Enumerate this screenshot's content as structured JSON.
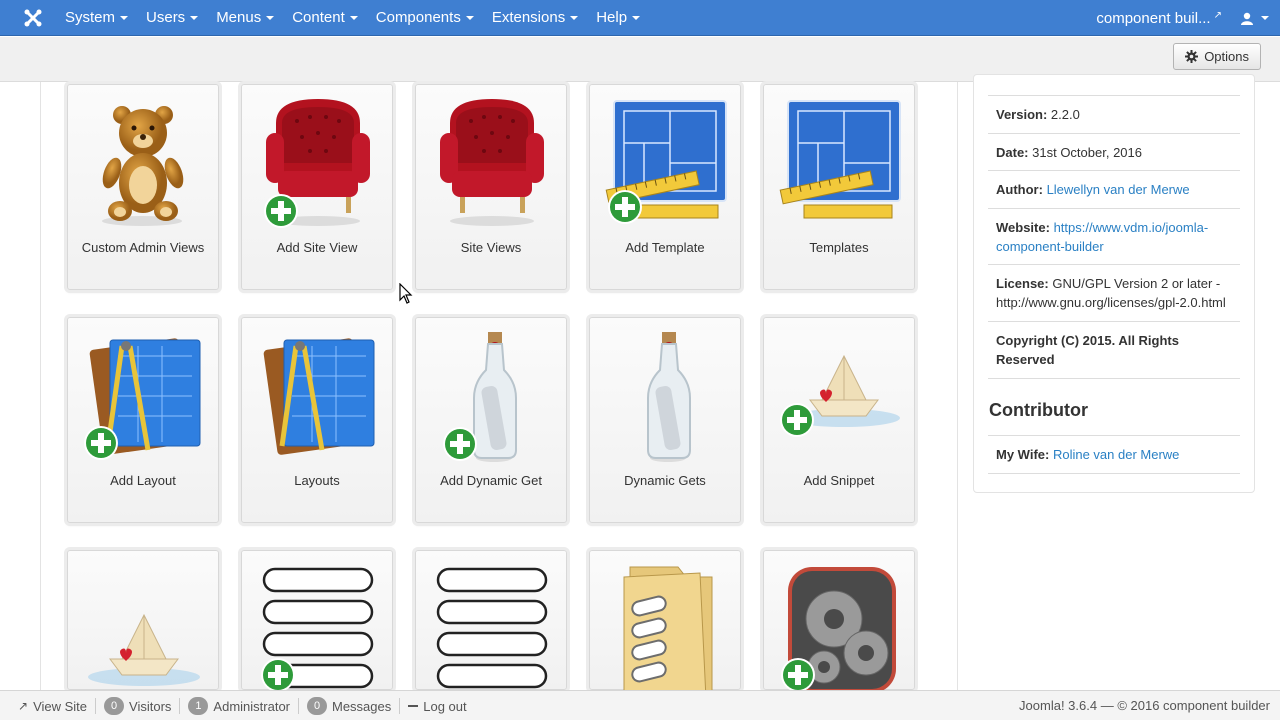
{
  "navbar": {
    "menu": [
      {
        "label": "System"
      },
      {
        "label": "Users"
      },
      {
        "label": "Menus"
      },
      {
        "label": "Content"
      },
      {
        "label": "Components"
      },
      {
        "label": "Extensions"
      },
      {
        "label": "Help"
      }
    ],
    "site_link": "component buil...",
    "accent_color": "#3f7fd1"
  },
  "toolbar": {
    "options_label": "Options"
  },
  "tiles": [
    {
      "label": "Custom Admin Views",
      "icon": "teddy-bear-icon"
    },
    {
      "label": "Add Site View",
      "icon": "armchair-icon"
    },
    {
      "label": "Site Views",
      "icon": "armchair-icon"
    },
    {
      "label": "Add Template",
      "icon": "blueprint-icon"
    },
    {
      "label": "Templates",
      "icon": "blueprint-icon"
    },
    {
      "label": "Add Layout",
      "icon": "drafting-book-icon"
    },
    {
      "label": "Layouts",
      "icon": "drafting-book-icon"
    },
    {
      "label": "Add Dynamic Get",
      "icon": "message-bottle-icon"
    },
    {
      "label": "Dynamic Gets",
      "icon": "message-bottle-icon"
    },
    {
      "label": "Add Snippet",
      "icon": "paper-boat-icon"
    },
    {
      "label": "",
      "icon": "paper-boat-icon"
    },
    {
      "label": "",
      "icon": "list-fields-icon"
    },
    {
      "label": "",
      "icon": "list-fields-icon"
    },
    {
      "label": "",
      "icon": "folder-icon"
    },
    {
      "label": "",
      "icon": "gears-icon"
    }
  ],
  "info": {
    "version_label": "Version:",
    "version": "2.2.0",
    "date_label": "Date:",
    "date": "31st October, 2016",
    "author_label": "Author:",
    "author": "Llewellyn van der Merwe",
    "website_label": "Website:",
    "website_line1": "https://www.vdm.io/joomla-",
    "website_line2": "component-builder",
    "license_label": "License:",
    "license_line1": "GNU/GPL Version 2 or later -",
    "license_line2": "http://www.gnu.org/licenses/gpl-2.0.html",
    "copyright_line1": "Copyright (C) 2015. All Rights",
    "copyright_line2": "Reserved",
    "contributor_heading": "Contributor",
    "contributor_label": "My Wife:",
    "contributor_name": "Roline van der Merwe"
  },
  "statusbar": {
    "view_site": "View Site",
    "visitors_count": "0",
    "visitors_label": "Visitors",
    "admins_count": "1",
    "admins_label": "Administrator",
    "messages_count": "0",
    "messages_label": "Messages",
    "logout_label": "Log out",
    "footer_text": "Joomla! 3.6.4 — © 2016 component builder"
  }
}
